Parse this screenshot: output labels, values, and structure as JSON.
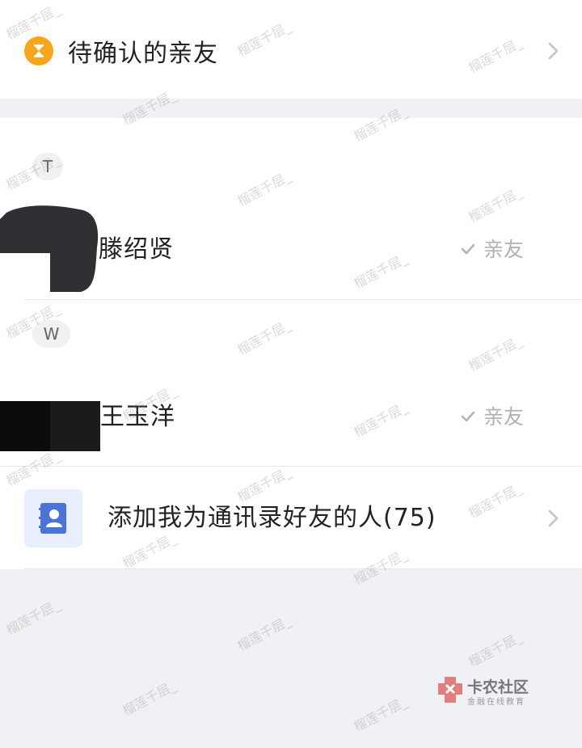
{
  "pending": {
    "label": "待确认的亲友"
  },
  "sections": [
    {
      "letter": "T",
      "contact": {
        "name": "滕绍贤",
        "status": "亲友"
      }
    },
    {
      "letter": "W",
      "contact": {
        "name": "王玉洋",
        "status": "亲友"
      }
    }
  ],
  "add_contacts": {
    "label": "添加我为通讯录好友的人(75)"
  },
  "watermark": {
    "text": "榴莲千层_"
  },
  "logo": {
    "name": "卡农社区",
    "tagline": "金融在线教育"
  },
  "colors": {
    "pending_icon": "#f6a51c",
    "contacts_icon": "#4b74d6",
    "background": "#f0f1f4"
  }
}
